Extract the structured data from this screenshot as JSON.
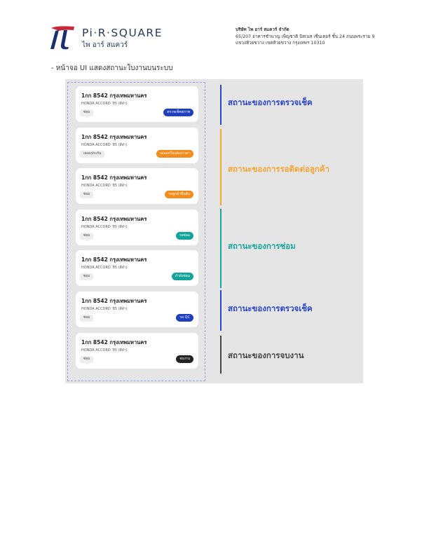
{
  "header": {
    "logo_word": "Pi·R·SQUARE",
    "logo_sub": "ไพ อาร์ สแควร์",
    "company_name": "บริษัท ไพ อาร์ สแควร์ จำกัด",
    "address_line1": "65/207 อาคารชำนาญ เพ็ญชาติ บิสเนส เซ็นเตอร์ ชั้น 24 ถนนพระราม 9",
    "address_line2": "แขวงห้วยขวาง เขตห้วยขวาง กรุงเทพฯ 10310"
  },
  "caption": "- หน้าจอ UI แสดงสถานะใบงานบนระบบ",
  "cards": [
    {
      "plate": "1กก 8542 กรุงเทพมหานคร",
      "model": "HONDA ACCORD '85 (สีดำ)",
      "tag": "ซ่อม",
      "status": "ตรวจเช็คสภาพ",
      "color": "#1f3fbf"
    },
    {
      "plate": "1กก 8542 กรุงเทพมหานคร",
      "model": "HONDA ACCORD '85 (สีดำ)",
      "tag": "เคลมประกัน",
      "status": "รอออกใบเสนอราคา",
      "color": "#f28c1c"
    },
    {
      "plate": "1กก 8542 กรุงเทพมหานคร",
      "model": "HONDA ACCORD '85 (สีดำ)",
      "tag": "ซ่อม",
      "status": "รอลูกค้ายืนยัน",
      "color": "#f28c1c"
    },
    {
      "plate": "1กก 8542 กรุงเทพมหานคร",
      "model": "HONDA ACCORD '85 (สีดำ)",
      "tag": "ซ่อม",
      "status": "รอซ่อม",
      "color": "#13a39a"
    },
    {
      "plate": "1กก 8542 กรุงเทพมหานคร",
      "model": "HONDA ACCORD '85 (สีดำ)",
      "tag": "ซ่อม",
      "status": "กำลังซ่อม",
      "color": "#13a39a"
    },
    {
      "plate": "1กก 8542 กรุงเทพมหานคร",
      "model": "HONDA ACCORD '85 (สีดำ)",
      "tag": "ซ่อม",
      "status": "รอ QC",
      "color": "#1f3fbf"
    },
    {
      "plate": "1กก 8542 กรุงเทพมหานคร",
      "model": "HONDA ACCORD '85 (สีดำ)",
      "tag": "ซ่อม",
      "status": "จบงาน",
      "color": "#222222"
    }
  ],
  "groups": [
    {
      "label": "สถานะของการตรวจเช็ค",
      "color": "#2b45c4"
    },
    {
      "label": "สถานะของการรอติดต่อลูกค้า",
      "color": "#f4a531"
    },
    {
      "label": "สถานะของการซ่อม",
      "color": "#15a6a0"
    },
    {
      "label": "สถานะของการตรวจเช็ค",
      "color": "#2b45c4"
    },
    {
      "label": "สถานะของการจบงาน",
      "color": "#444444"
    }
  ]
}
